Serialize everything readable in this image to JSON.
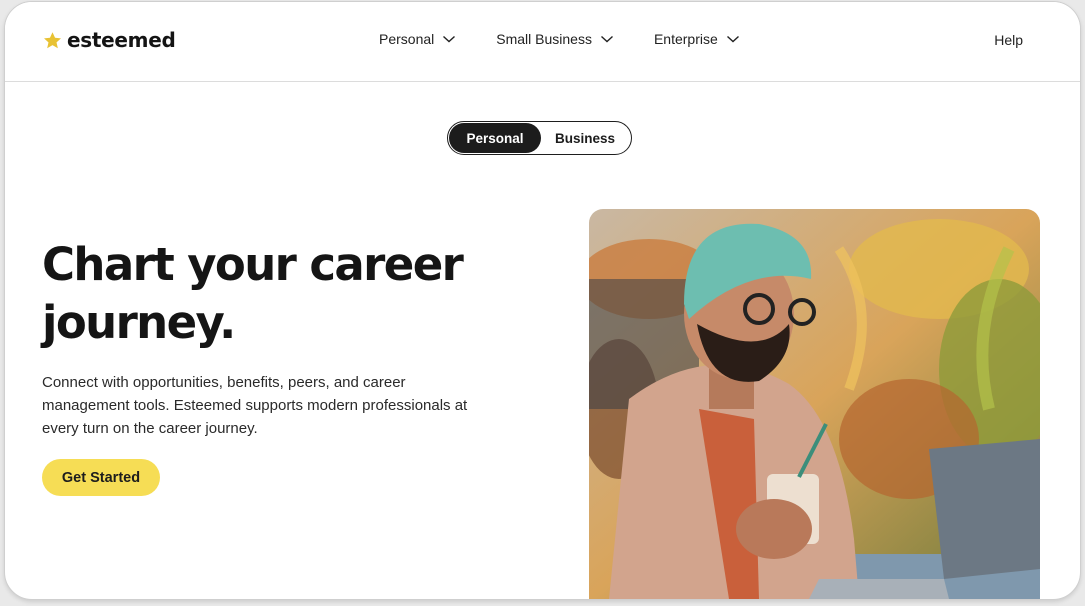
{
  "brand": {
    "name": "esteemed",
    "logo_icon": "star-icon",
    "logo_color": "#e8c234"
  },
  "nav": {
    "items": [
      {
        "label": "Personal",
        "icon": "chevron-down-icon"
      },
      {
        "label": "Small Business",
        "icon": "chevron-down-icon"
      },
      {
        "label": "Enterprise",
        "icon": "chevron-down-icon"
      }
    ],
    "help_label": "Help"
  },
  "audience_toggle": {
    "options": [
      "Personal",
      "Business"
    ],
    "selected": "Personal"
  },
  "hero": {
    "title": "Chart your career journey.",
    "description": "Connect with opportunities, benefits, peers, and career management tools. Esteemed supports modern professionals at every turn on the career journey.",
    "cta_label": "Get Started",
    "cta_color": "#f6dd55"
  },
  "colors": {
    "text": "#151515",
    "toggle_active": "#1c1c1c",
    "background": "#ffffff"
  }
}
